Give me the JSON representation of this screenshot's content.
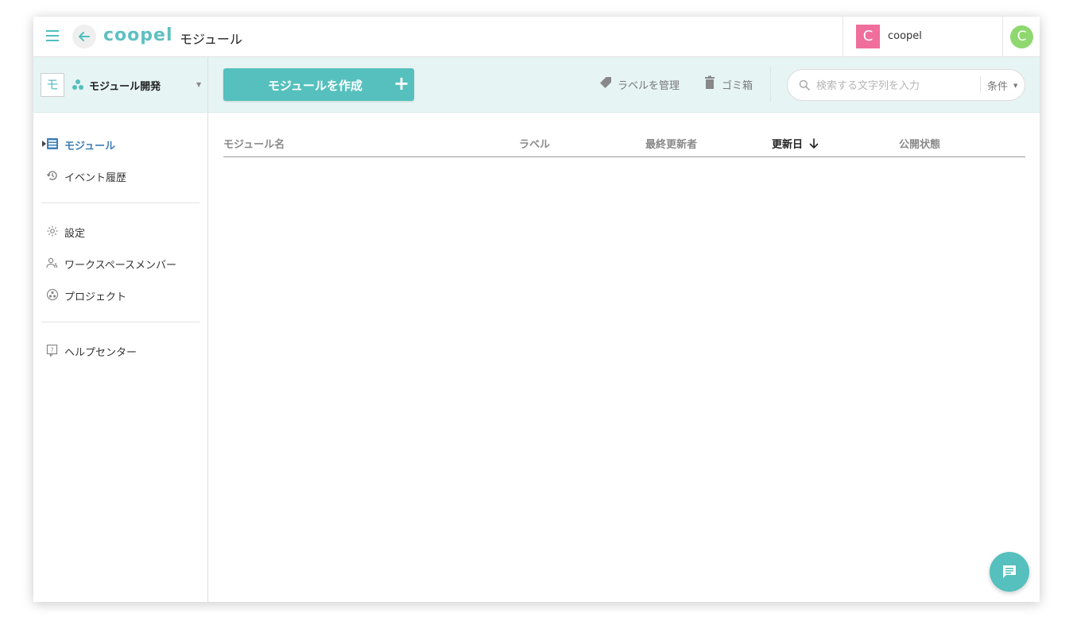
{
  "header": {
    "logo": "coopel",
    "page_title": "モジュール",
    "org": {
      "avatar_letter": "C",
      "name": "coopel",
      "color": "#f06e9b"
    },
    "user_avatar_letter": "C",
    "user_avatar_color": "#8ed86f"
  },
  "sidebar": {
    "workspace": {
      "badge": "モ",
      "name": "モジュール開発",
      "icon": "modules-icon"
    },
    "items": [
      {
        "label": "モジュール",
        "icon": "module-list-icon",
        "active": true
      },
      {
        "label": "イベント履歴",
        "icon": "history-icon",
        "active": false
      },
      {
        "label": "設定",
        "icon": "gear-icon",
        "active": false
      },
      {
        "label": "ワークスペースメンバー",
        "icon": "members-icon",
        "active": false
      },
      {
        "label": "プロジェクト",
        "icon": "project-icon",
        "active": false
      },
      {
        "label": "ヘルプセンター",
        "icon": "help-icon",
        "active": false
      }
    ]
  },
  "toolbar": {
    "create_label": "モジュールを作成",
    "manage_labels": "ラベルを管理",
    "trash": "ゴミ箱",
    "search_placeholder": "検索する文字列を入力",
    "conditions": "条件"
  },
  "table": {
    "columns": [
      "モジュール名",
      "ラベル",
      "最終更新者",
      "更新日",
      "公開状態"
    ],
    "sorted_column": "更新日",
    "sort_direction": "descending",
    "rows": []
  },
  "colors": {
    "accent": "#55c0bd",
    "toolbar_bg": "#e6f4f4",
    "active_nav": "#3f7fb6"
  }
}
